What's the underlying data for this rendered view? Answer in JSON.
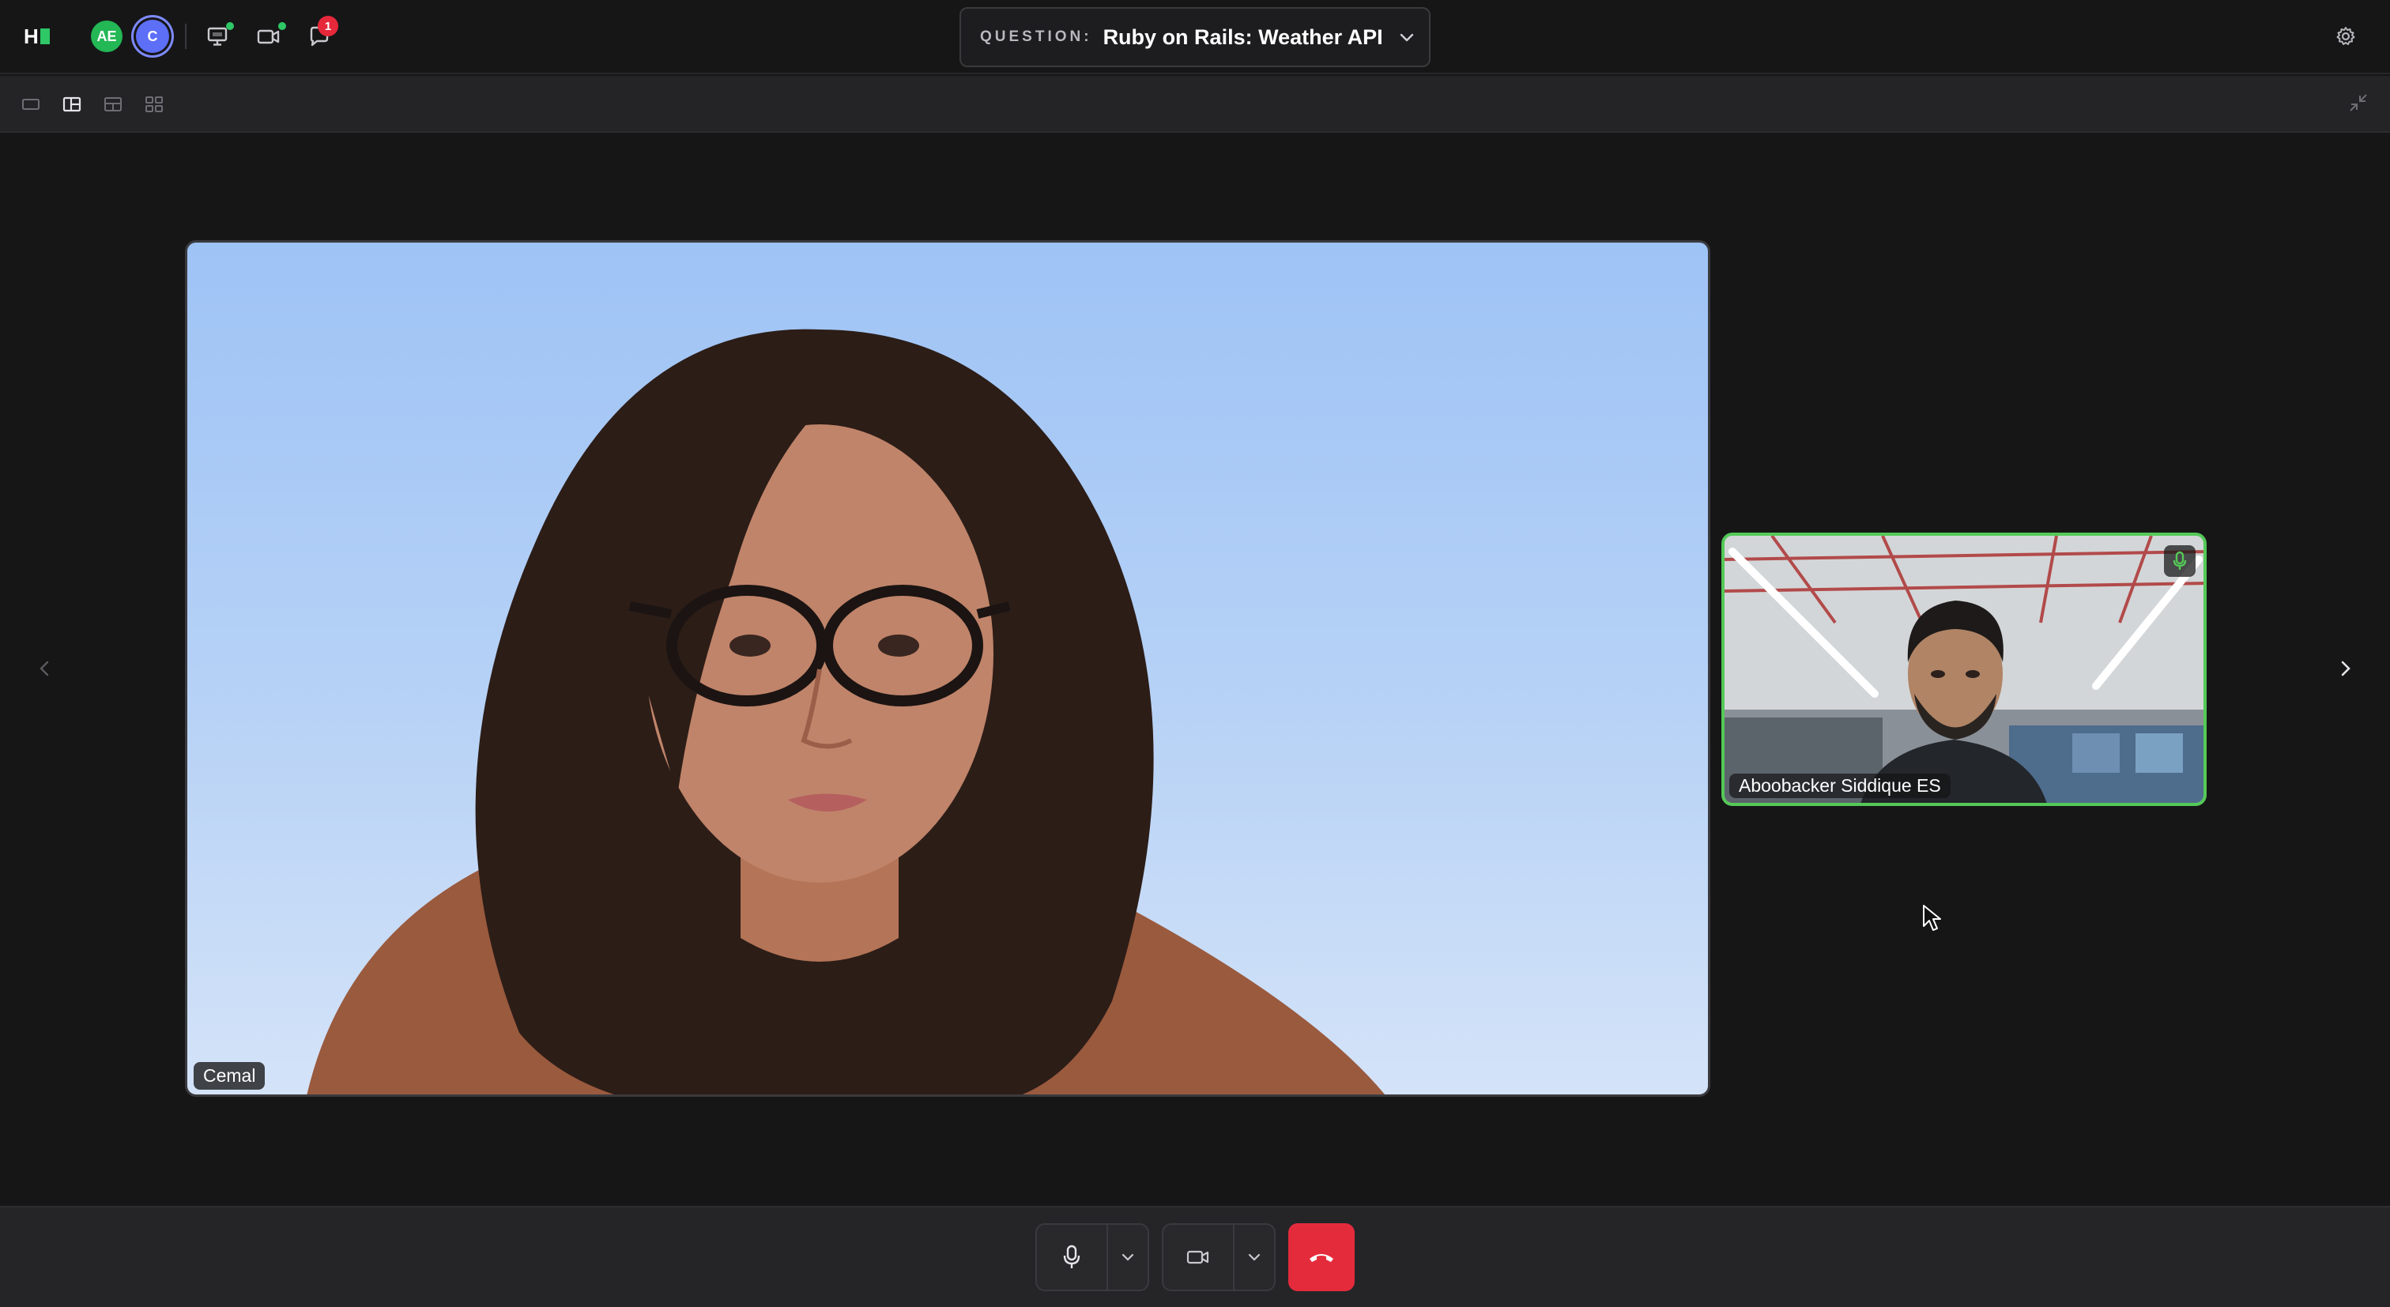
{
  "app": {
    "logo_text": "H"
  },
  "participants_header": {
    "avatars": [
      {
        "initials": "AE",
        "color": "#23b755"
      },
      {
        "initials": "C",
        "color": "#5d6ef7"
      }
    ]
  },
  "toolbar": {
    "icons": [
      "screen-share-icon",
      "video-icon",
      "chat-icon"
    ],
    "chat_badge": "1"
  },
  "question": {
    "label": "QUESTION:",
    "title": "Ruby on Rails: Weather API"
  },
  "layout_options": [
    "single-view-icon",
    "sidebar-view-icon",
    "split-view-icon",
    "grid-view-icon"
  ],
  "main_video": {
    "name": "Cemal"
  },
  "side_video": {
    "name": "Aboobacker Siddique ES",
    "speaking": true
  },
  "colors": {
    "accent_green": "#2ec866",
    "speaking_border": "#54c957",
    "end_call": "#e42b3c",
    "badge": "#e6283b"
  }
}
